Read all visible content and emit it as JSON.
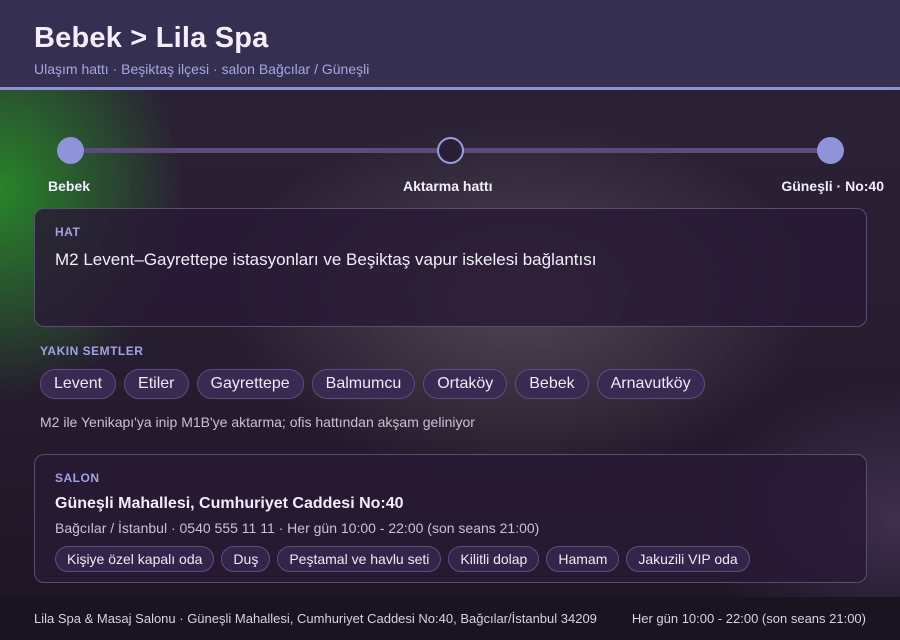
{
  "header": {
    "title": "Bebek > Lila Spa",
    "subtitle": "Ulaşım hattı · Beşiktaş ilçesi · salon Bağcılar / Güneşli"
  },
  "timeline": {
    "stops": [
      {
        "label": "Bebek"
      },
      {
        "label": "Aktarma hattı"
      },
      {
        "label": "Güneşli · No:40"
      }
    ]
  },
  "line_card": {
    "label": "HAT",
    "text": "M2 Levent–Gayrettepe istasyonları ve Beşiktaş vapur iskelesi bağlantısı"
  },
  "nearby": {
    "label": "YAKIN SEMTLER",
    "items": [
      "Levent",
      "Etiler",
      "Gayrettepe",
      "Balmumcu",
      "Ortaköy",
      "Bebek",
      "Arnavutköy"
    ],
    "note": "M2 ile Yenikapı'ya inip M1B'ye aktarma; ofis hattından akşam geliniyor"
  },
  "salon": {
    "label": "SALON",
    "name": "Güneşli Mahallesi, Cumhuriyet Caddesi No:40",
    "info": "Bağcılar / İstanbul · 0540 555 11 11 · Her gün 10:00 - 22:00 (son seans 21:00)",
    "amenities": [
      "Kişiye özel kapalı oda",
      "Duş",
      "Peştamal ve havlu seti",
      "Kilitli dolap",
      "Hamam",
      "Jakuzili VIP oda"
    ]
  },
  "footer": {
    "left": "Lila Spa & Masaj Salonu · Güneşli Mahallesi, Cumhuriyet Caddesi No:40, Bağcılar/İstanbul 34209",
    "right": "Her gün 10:00 - 22:00 (son seans 21:00)"
  },
  "colors": {
    "accent": "#8e91d6",
    "header_bg": "#352f52",
    "card_bg": "#281a34"
  }
}
